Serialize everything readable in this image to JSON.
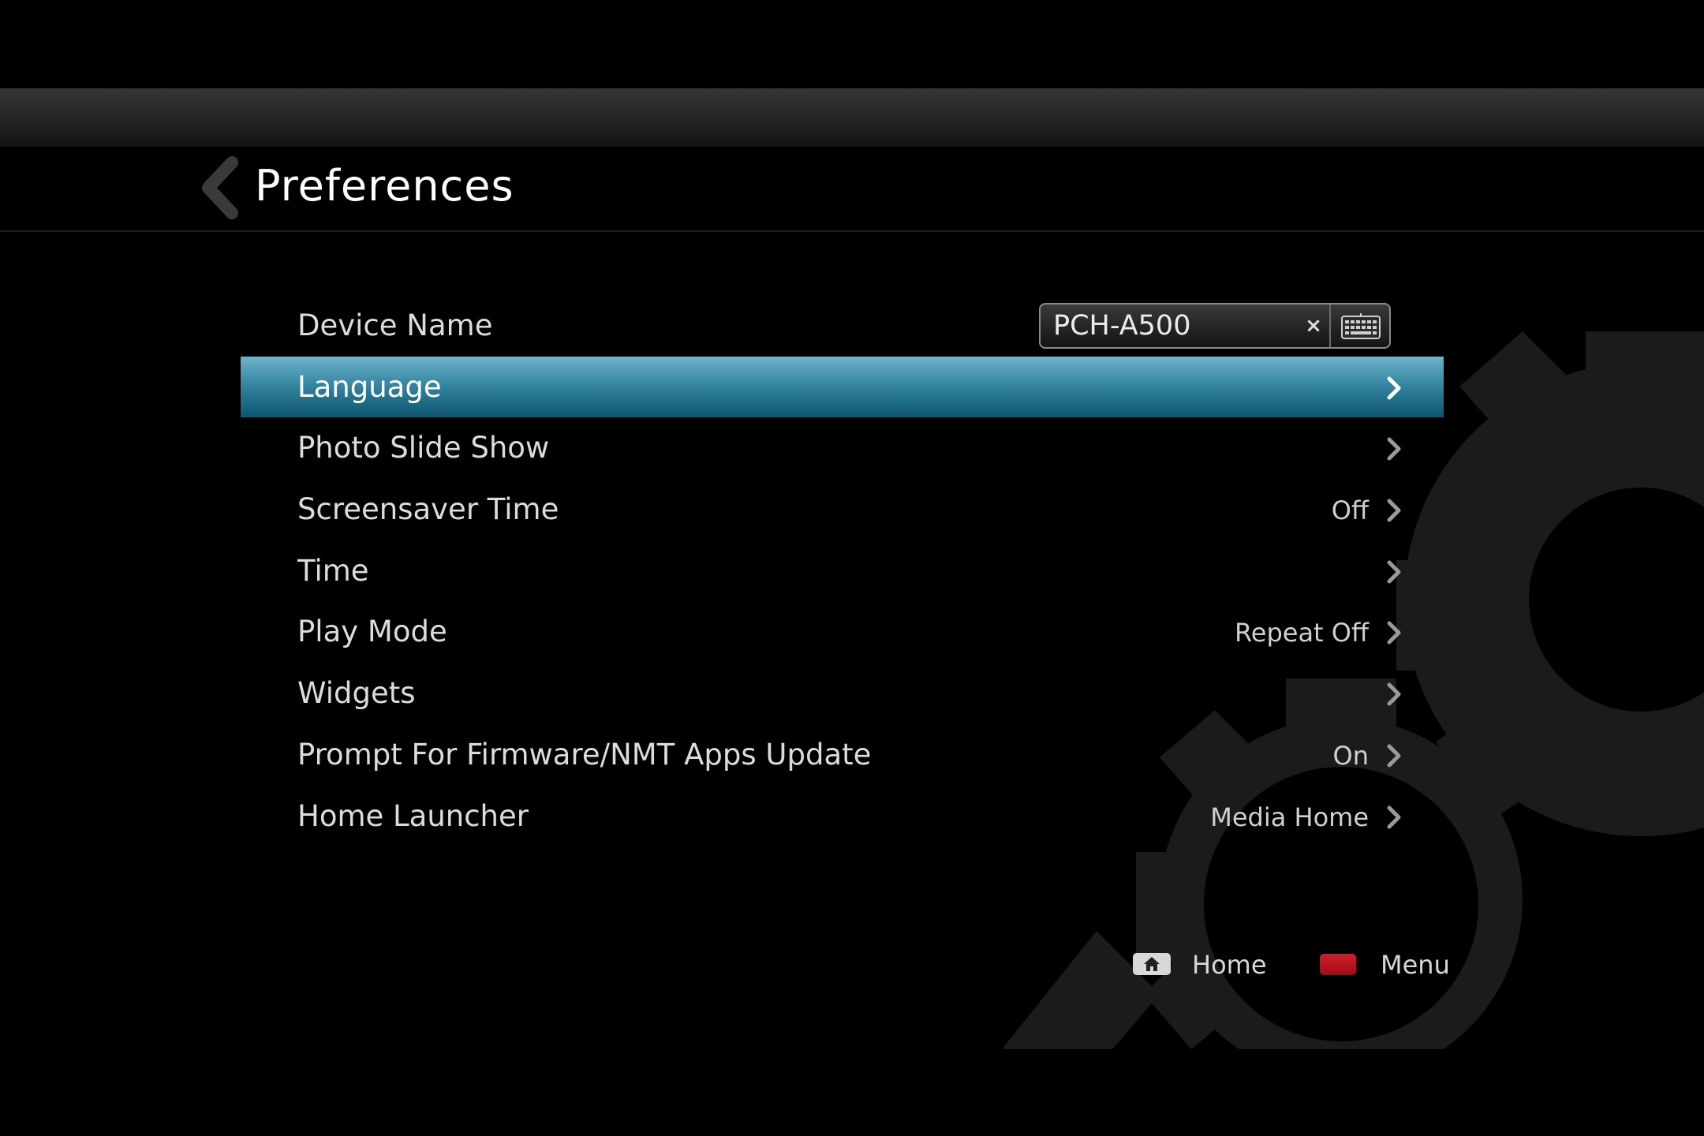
{
  "header": {
    "title": "Preferences",
    "back_icon": "chevron-left-icon"
  },
  "device_name": {
    "label": "Device Name",
    "value": "PCH-A500",
    "clear_glyph": "×",
    "keyboard_icon": "keyboard-icon"
  },
  "menu_items": [
    {
      "id": "language",
      "label": "Language",
      "value": "",
      "selected": true
    },
    {
      "id": "photo-slide-show",
      "label": "Photo Slide Show",
      "value": ""
    },
    {
      "id": "screensaver-time",
      "label": "Screensaver Time",
      "value": "Off"
    },
    {
      "id": "time",
      "label": "Time",
      "value": ""
    },
    {
      "id": "play-mode",
      "label": "Play Mode",
      "value": "Repeat Off"
    },
    {
      "id": "widgets",
      "label": "Widgets",
      "value": ""
    },
    {
      "id": "prompt-firmware-update",
      "label": "Prompt For Firmware/NMT Apps Update",
      "value": "On"
    },
    {
      "id": "home-launcher",
      "label": "Home Launcher",
      "value": "Media Home"
    }
  ],
  "footer": {
    "home_label": "Home",
    "home_icon": "home-icon",
    "menu_label": "Menu",
    "menu_key_color": "#b3101b"
  },
  "colors": {
    "selection_top": "#6fb3cc",
    "selection_bottom": "#10566f",
    "background": "#000000"
  }
}
